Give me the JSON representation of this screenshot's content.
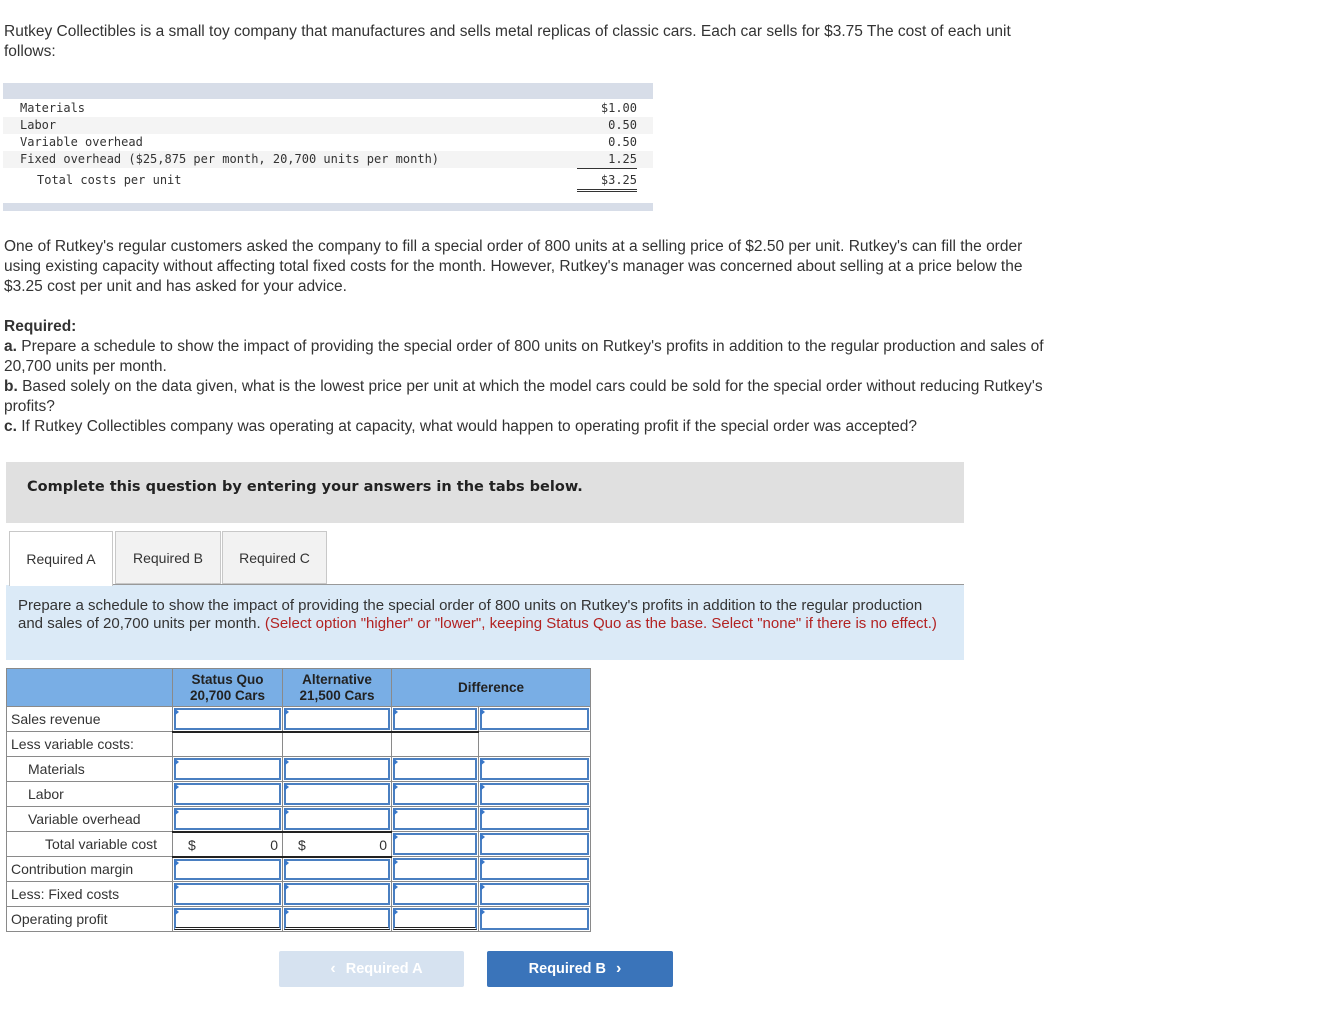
{
  "intro": "Rutkey Collectibles is a small toy company that manufactures and sells metal replicas of classic cars. Each car sells for $3.75 The cost of each unit follows:",
  "cost_table": {
    "rows": [
      {
        "label": "Materials",
        "value": "$1.00"
      },
      {
        "label": "Labor",
        "value": "0.50"
      },
      {
        "label": "Variable overhead",
        "value": "0.50"
      },
      {
        "label": "Fixed overhead ($25,875 per month, 20,700 units per month)",
        "value": "1.25"
      }
    ],
    "total": {
      "label": "Total costs per unit",
      "value": "$3.25"
    }
  },
  "special_order": "One of Rutkey's regular customers asked the company to fill a special order of 800 units at a selling price of $2.50 per unit. Rutkey's can fill the order using existing capacity without affecting total fixed costs for the month. However, Rutkey's manager was concerned about selling at a price below the $3.25 cost per unit and has asked for your advice.",
  "required": {
    "heading": "Required:",
    "items": [
      {
        "letter": "a.",
        "text": " Prepare a schedule to show the impact of providing the special order of 800 units on Rutkey's profits in addition to the regular production and sales of 20,700 units per month."
      },
      {
        "letter": "b.",
        "text": " Based solely on the data given, what is the lowest price per unit at which the model cars could be sold for the special order without reducing Rutkey's profits?"
      },
      {
        "letter": "c.",
        "text": " If Rutkey Collectibles company was operating at capacity, what would happen to operating profit if the special order was accepted?"
      }
    ]
  },
  "instruction": "Complete this question by entering your answers in the tabs below.",
  "tabs": [
    {
      "label": "Required A",
      "active": true
    },
    {
      "label": "Required B",
      "active": false
    },
    {
      "label": "Required C",
      "active": false
    }
  ],
  "prompt": {
    "text": "Prepare a schedule to show the impact of providing the special order of 800 units on Rutkey's profits in addition to the regular production and sales of 20,700 units per month. ",
    "note": "(Select option \"higher\" or \"lower\", keeping Status Quo as the base. Select \"none\" if there is no effect.)"
  },
  "schedule": {
    "headers": {
      "status_quo_line1": "Status Quo",
      "status_quo_line2": "20,700 Cars",
      "alternative_line1": "Alternative",
      "alternative_line2": "21,500 Cars",
      "difference": "Difference"
    },
    "rows": [
      {
        "label": "Sales revenue"
      },
      {
        "label": "Less variable costs:"
      },
      {
        "label": "Materials"
      },
      {
        "label": "Labor"
      },
      {
        "label": "Variable overhead"
      },
      {
        "label": "Total variable cost",
        "status_quo": {
          "currency": "$",
          "value": "0"
        },
        "alternative": {
          "currency": "$",
          "value": "0"
        }
      },
      {
        "label": "Contribution margin"
      },
      {
        "label": "Less: Fixed costs"
      },
      {
        "label": "Operating profit"
      }
    ]
  },
  "nav": {
    "prev_label": "Required A",
    "next_label": "Required B",
    "prev_icon": "chevron-left-icon",
    "next_icon": "chevron-right-icon"
  }
}
